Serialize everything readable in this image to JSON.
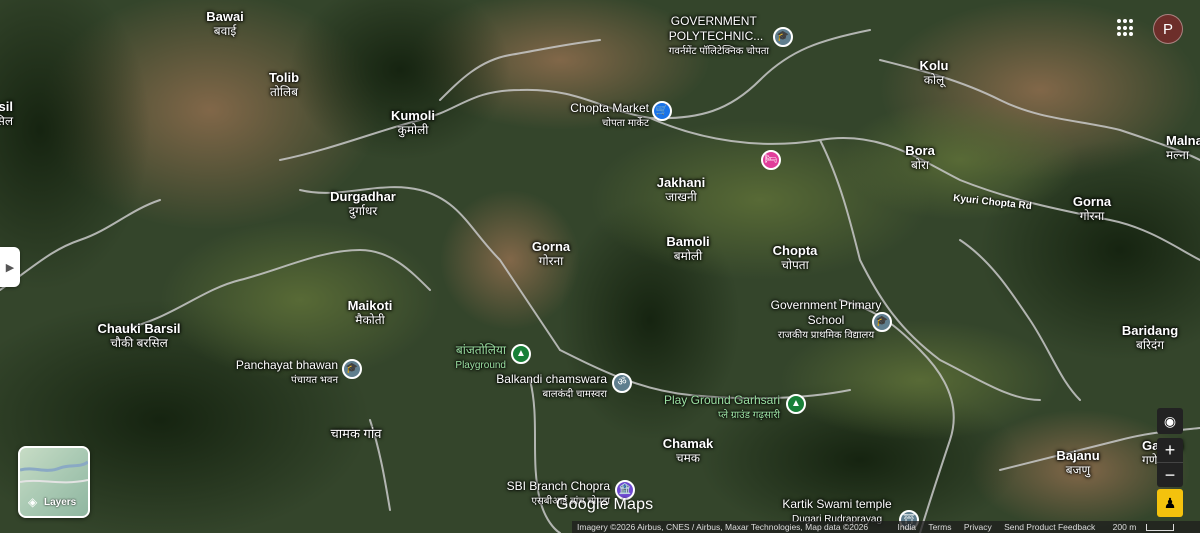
{
  "map": {
    "places": [
      {
        "name": "Bawai",
        "sub": "बवाई"
      },
      {
        "name": "Tolib",
        "sub": "तोलिब"
      },
      {
        "name": "Kumoli",
        "sub": "कुमोली"
      },
      {
        "name": "Durgadhar",
        "sub": "दुर्गाधर"
      },
      {
        "name": "Maikoti",
        "sub": "मैकोती"
      },
      {
        "name": "Chauki Barsil",
        "sub": "चौकी बरसिल"
      },
      {
        "name": "Gorna",
        "sub": "गोरना"
      },
      {
        "name": "Jakhani",
        "sub": "जाखनी"
      },
      {
        "name": "Bamoli",
        "sub": "बमोली"
      },
      {
        "name": "Chopta",
        "sub": "चोपता"
      },
      {
        "name": "Kolu",
        "sub": "कोलू"
      },
      {
        "name": "Bora",
        "sub": "बोरा"
      },
      {
        "name": "Gorna",
        "sub": "गोरना"
      },
      {
        "name": "Baridang",
        "sub": "बरिदंग"
      },
      {
        "name": "Malna",
        "sub": "मल्ना"
      },
      {
        "name": "Chamak",
        "sub": "चमक"
      },
      {
        "name": "Bajanu",
        "sub": "बजणु"
      },
      {
        "name": "Ganeri",
        "sub": "गणेरी"
      },
      {
        "name": "sil",
        "sub": "सिल"
      },
      {
        "name": "चामक गांव",
        "sub": ""
      }
    ],
    "pois": [
      {
        "name": "GOVERNMENT POLYTECHNIC...",
        "sub": "गवर्नमेंट पॉलिटेक्निक चोपता",
        "icon": "school-icon",
        "color": "#5f7e8e"
      },
      {
        "name": "Chopta Market",
        "sub": "चोपता मार्केट",
        "icon": "shopping-cart-icon",
        "color": "#1a73e8"
      },
      {
        "name": "Government Primary School",
        "sub": "राजकीय प्राथमिक विद्यालय",
        "icon": "school-icon",
        "color": "#5f7e8e"
      },
      {
        "name": "Panchayat bhawan",
        "sub": "पंचायत भवन",
        "icon": "school-icon",
        "color": "#5f7e8e"
      },
      {
        "name": "बांजतोलिया",
        "sub": "Playground",
        "icon": "tree-icon",
        "color": "#188038"
      },
      {
        "name": "Balkandi chamswara",
        "sub": "बालकंदी चामस्वरा",
        "icon": "om-icon",
        "color": "#5f7e8e"
      },
      {
        "name": "Play Ground Garhsari",
        "sub": "प्ले ग्राउंड गढ़सारी",
        "icon": "tree-icon",
        "color": "#188038"
      },
      {
        "name": "SBI Branch Chopra",
        "sub": "एसबीआई ब्रांच चोपड़ा",
        "icon": "bank-icon",
        "color": "#6f4ad1"
      },
      {
        "name": "Kartik Swami temple",
        "sub": "Dugari Rudraprayag",
        "icon": "temple-icon",
        "color": "#5f7e8e"
      },
      {
        "name": "",
        "sub": "",
        "icon": "hotel-icon",
        "color": "#e13d9a"
      }
    ],
    "road_label": "Kyuri Chopta Rd"
  },
  "ui": {
    "layers_label": "Layers",
    "avatar_letter": "P",
    "zoom_in": "+",
    "zoom_out": "−",
    "logo": "Google Maps",
    "attribution": "Imagery ©2026 Airbus, CNES / Airbus, Maxar Technologies, Map data ©2026",
    "footer_links": [
      "India",
      "Terms",
      "Privacy",
      "Send Product Feedback"
    ],
    "scale": "200 m"
  },
  "colors": {
    "poi_green": "#9be0a2",
    "road": "#c9c9c9"
  }
}
